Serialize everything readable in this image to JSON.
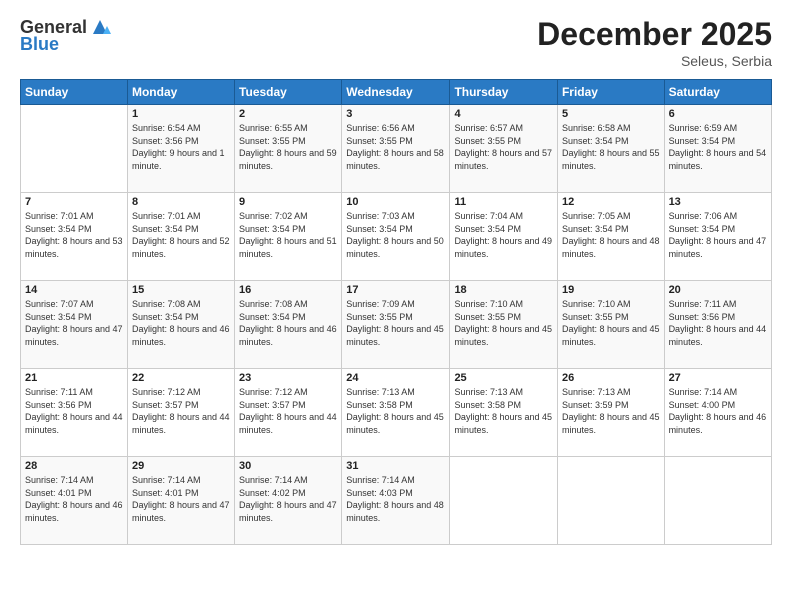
{
  "logo": {
    "general": "General",
    "blue": "Blue"
  },
  "title": "December 2025",
  "subtitle": "Seleus, Serbia",
  "days_header": [
    "Sunday",
    "Monday",
    "Tuesday",
    "Wednesday",
    "Thursday",
    "Friday",
    "Saturday"
  ],
  "weeks": [
    [
      {
        "num": "",
        "sunrise": "",
        "sunset": "",
        "daylight": ""
      },
      {
        "num": "1",
        "sunrise": "Sunrise: 6:54 AM",
        "sunset": "Sunset: 3:56 PM",
        "daylight": "Daylight: 9 hours and 1 minute."
      },
      {
        "num": "2",
        "sunrise": "Sunrise: 6:55 AM",
        "sunset": "Sunset: 3:55 PM",
        "daylight": "Daylight: 8 hours and 59 minutes."
      },
      {
        "num": "3",
        "sunrise": "Sunrise: 6:56 AM",
        "sunset": "Sunset: 3:55 PM",
        "daylight": "Daylight: 8 hours and 58 minutes."
      },
      {
        "num": "4",
        "sunrise": "Sunrise: 6:57 AM",
        "sunset": "Sunset: 3:55 PM",
        "daylight": "Daylight: 8 hours and 57 minutes."
      },
      {
        "num": "5",
        "sunrise": "Sunrise: 6:58 AM",
        "sunset": "Sunset: 3:54 PM",
        "daylight": "Daylight: 8 hours and 55 minutes."
      },
      {
        "num": "6",
        "sunrise": "Sunrise: 6:59 AM",
        "sunset": "Sunset: 3:54 PM",
        "daylight": "Daylight: 8 hours and 54 minutes."
      }
    ],
    [
      {
        "num": "7",
        "sunrise": "Sunrise: 7:01 AM",
        "sunset": "Sunset: 3:54 PM",
        "daylight": "Daylight: 8 hours and 53 minutes."
      },
      {
        "num": "8",
        "sunrise": "Sunrise: 7:01 AM",
        "sunset": "Sunset: 3:54 PM",
        "daylight": "Daylight: 8 hours and 52 minutes."
      },
      {
        "num": "9",
        "sunrise": "Sunrise: 7:02 AM",
        "sunset": "Sunset: 3:54 PM",
        "daylight": "Daylight: 8 hours and 51 minutes."
      },
      {
        "num": "10",
        "sunrise": "Sunrise: 7:03 AM",
        "sunset": "Sunset: 3:54 PM",
        "daylight": "Daylight: 8 hours and 50 minutes."
      },
      {
        "num": "11",
        "sunrise": "Sunrise: 7:04 AM",
        "sunset": "Sunset: 3:54 PM",
        "daylight": "Daylight: 8 hours and 49 minutes."
      },
      {
        "num": "12",
        "sunrise": "Sunrise: 7:05 AM",
        "sunset": "Sunset: 3:54 PM",
        "daylight": "Daylight: 8 hours and 48 minutes."
      },
      {
        "num": "13",
        "sunrise": "Sunrise: 7:06 AM",
        "sunset": "Sunset: 3:54 PM",
        "daylight": "Daylight: 8 hours and 47 minutes."
      }
    ],
    [
      {
        "num": "14",
        "sunrise": "Sunrise: 7:07 AM",
        "sunset": "Sunset: 3:54 PM",
        "daylight": "Daylight: 8 hours and 47 minutes."
      },
      {
        "num": "15",
        "sunrise": "Sunrise: 7:08 AM",
        "sunset": "Sunset: 3:54 PM",
        "daylight": "Daylight: 8 hours and 46 minutes."
      },
      {
        "num": "16",
        "sunrise": "Sunrise: 7:08 AM",
        "sunset": "Sunset: 3:54 PM",
        "daylight": "Daylight: 8 hours and 46 minutes."
      },
      {
        "num": "17",
        "sunrise": "Sunrise: 7:09 AM",
        "sunset": "Sunset: 3:55 PM",
        "daylight": "Daylight: 8 hours and 45 minutes."
      },
      {
        "num": "18",
        "sunrise": "Sunrise: 7:10 AM",
        "sunset": "Sunset: 3:55 PM",
        "daylight": "Daylight: 8 hours and 45 minutes."
      },
      {
        "num": "19",
        "sunrise": "Sunrise: 7:10 AM",
        "sunset": "Sunset: 3:55 PM",
        "daylight": "Daylight: 8 hours and 45 minutes."
      },
      {
        "num": "20",
        "sunrise": "Sunrise: 7:11 AM",
        "sunset": "Sunset: 3:56 PM",
        "daylight": "Daylight: 8 hours and 44 minutes."
      }
    ],
    [
      {
        "num": "21",
        "sunrise": "Sunrise: 7:11 AM",
        "sunset": "Sunset: 3:56 PM",
        "daylight": "Daylight: 8 hours and 44 minutes."
      },
      {
        "num": "22",
        "sunrise": "Sunrise: 7:12 AM",
        "sunset": "Sunset: 3:57 PM",
        "daylight": "Daylight: 8 hours and 44 minutes."
      },
      {
        "num": "23",
        "sunrise": "Sunrise: 7:12 AM",
        "sunset": "Sunset: 3:57 PM",
        "daylight": "Daylight: 8 hours and 44 minutes."
      },
      {
        "num": "24",
        "sunrise": "Sunrise: 7:13 AM",
        "sunset": "Sunset: 3:58 PM",
        "daylight": "Daylight: 8 hours and 45 minutes."
      },
      {
        "num": "25",
        "sunrise": "Sunrise: 7:13 AM",
        "sunset": "Sunset: 3:58 PM",
        "daylight": "Daylight: 8 hours and 45 minutes."
      },
      {
        "num": "26",
        "sunrise": "Sunrise: 7:13 AM",
        "sunset": "Sunset: 3:59 PM",
        "daylight": "Daylight: 8 hours and 45 minutes."
      },
      {
        "num": "27",
        "sunrise": "Sunrise: 7:14 AM",
        "sunset": "Sunset: 4:00 PM",
        "daylight": "Daylight: 8 hours and 46 minutes."
      }
    ],
    [
      {
        "num": "28",
        "sunrise": "Sunrise: 7:14 AM",
        "sunset": "Sunset: 4:01 PM",
        "daylight": "Daylight: 8 hours and 46 minutes."
      },
      {
        "num": "29",
        "sunrise": "Sunrise: 7:14 AM",
        "sunset": "Sunset: 4:01 PM",
        "daylight": "Daylight: 8 hours and 47 minutes."
      },
      {
        "num": "30",
        "sunrise": "Sunrise: 7:14 AM",
        "sunset": "Sunset: 4:02 PM",
        "daylight": "Daylight: 8 hours and 47 minutes."
      },
      {
        "num": "31",
        "sunrise": "Sunrise: 7:14 AM",
        "sunset": "Sunset: 4:03 PM",
        "daylight": "Daylight: 8 hours and 48 minutes."
      },
      {
        "num": "",
        "sunrise": "",
        "sunset": "",
        "daylight": ""
      },
      {
        "num": "",
        "sunrise": "",
        "sunset": "",
        "daylight": ""
      },
      {
        "num": "",
        "sunrise": "",
        "sunset": "",
        "daylight": ""
      }
    ]
  ]
}
